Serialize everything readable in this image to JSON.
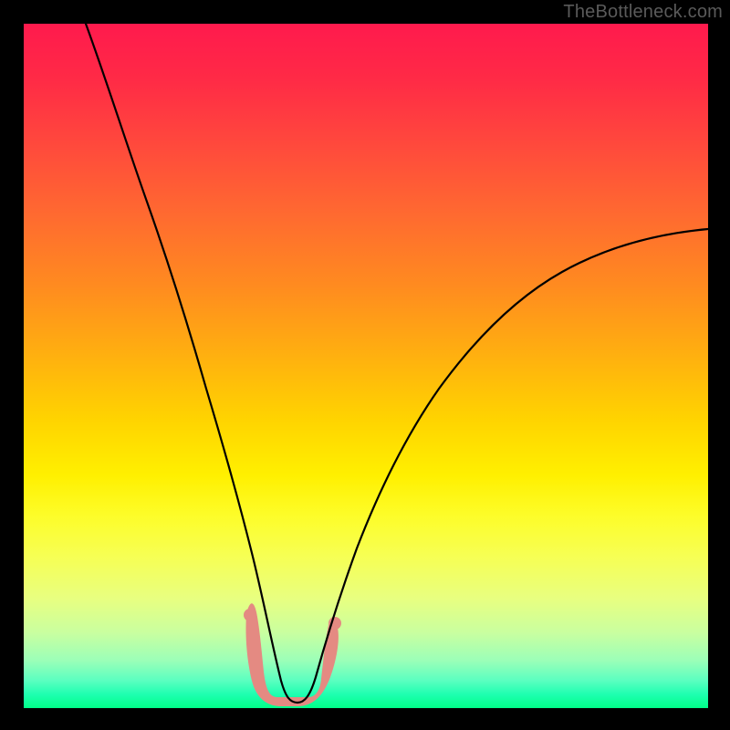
{
  "watermark": "TheBottleneck.com",
  "chart_data": {
    "type": "line",
    "title": "",
    "xlabel": "",
    "ylabel": "",
    "xlim": [
      0,
      100
    ],
    "ylim": [
      0,
      100
    ],
    "grid": false,
    "legend": false,
    "background_gradient": {
      "orientation": "vertical",
      "stops": [
        {
          "pos": 0.0,
          "color": "#ff1a4d"
        },
        {
          "pos": 0.18,
          "color": "#ff4a3c"
        },
        {
          "pos": 0.38,
          "color": "#ff8a20"
        },
        {
          "pos": 0.58,
          "color": "#ffd400"
        },
        {
          "pos": 0.72,
          "color": "#fdfd2a"
        },
        {
          "pos": 0.86,
          "color": "#d0ff90"
        },
        {
          "pos": 1.0,
          "color": "#00ff88"
        }
      ]
    },
    "series": [
      {
        "name": "bottleneck-curve",
        "stroke": "#000000",
        "x": [
          9,
          12,
          15,
          18,
          21,
          24,
          26,
          28,
          30,
          32,
          33.5,
          35,
          37,
          39,
          40.5,
          41.5,
          43,
          46,
          50,
          55,
          60,
          65,
          70,
          75,
          80,
          85,
          90,
          95,
          100
        ],
        "y": [
          100,
          90,
          80,
          70,
          60,
          50,
          42,
          35,
          27,
          19,
          13,
          8,
          4,
          2,
          1.5,
          1.5,
          2,
          3.5,
          7,
          13,
          20,
          27,
          34,
          41,
          47,
          52,
          57,
          61,
          65
        ]
      }
    ],
    "highlight_region": {
      "shape": "flat-bottom-arc",
      "color": "#e48a82",
      "x_range": [
        32.5,
        43
      ],
      "y_range": [
        1,
        14
      ]
    }
  }
}
